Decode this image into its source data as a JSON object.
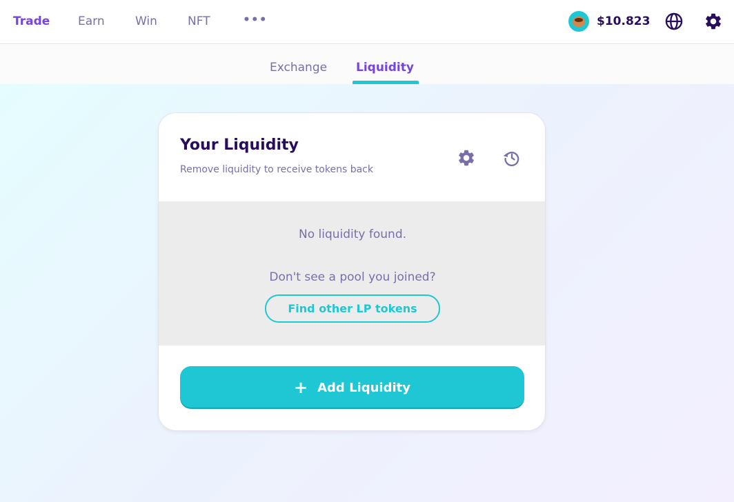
{
  "nav": {
    "items": [
      {
        "label": "Trade"
      },
      {
        "label": "Earn"
      },
      {
        "label": "Win"
      },
      {
        "label": "NFT"
      },
      {
        "label": "•••"
      }
    ],
    "cake_price": "$10.823",
    "icons": {
      "price": "cake-icon",
      "language": "globe-icon",
      "settings": "gear-icon"
    }
  },
  "subnav": {
    "tabs": [
      {
        "label": "Exchange"
      },
      {
        "label": "Liquidity"
      }
    ]
  },
  "card": {
    "title": "Your Liquidity",
    "subtitle": "Remove liquidity to receive tokens back",
    "empty_text": "No liquidity found.",
    "pool_question": "Don't see a pool you joined?",
    "find_button": "Find other LP tokens",
    "add_button": "Add Liquidity",
    "add_icon": "+",
    "icons": {
      "settings": "gear-icon",
      "history": "history-icon"
    }
  },
  "colors": {
    "primary": "#1fc7d4",
    "secondary": "#7645d9",
    "text": "#280d5f",
    "text_subtle": "#7a6eaa"
  }
}
